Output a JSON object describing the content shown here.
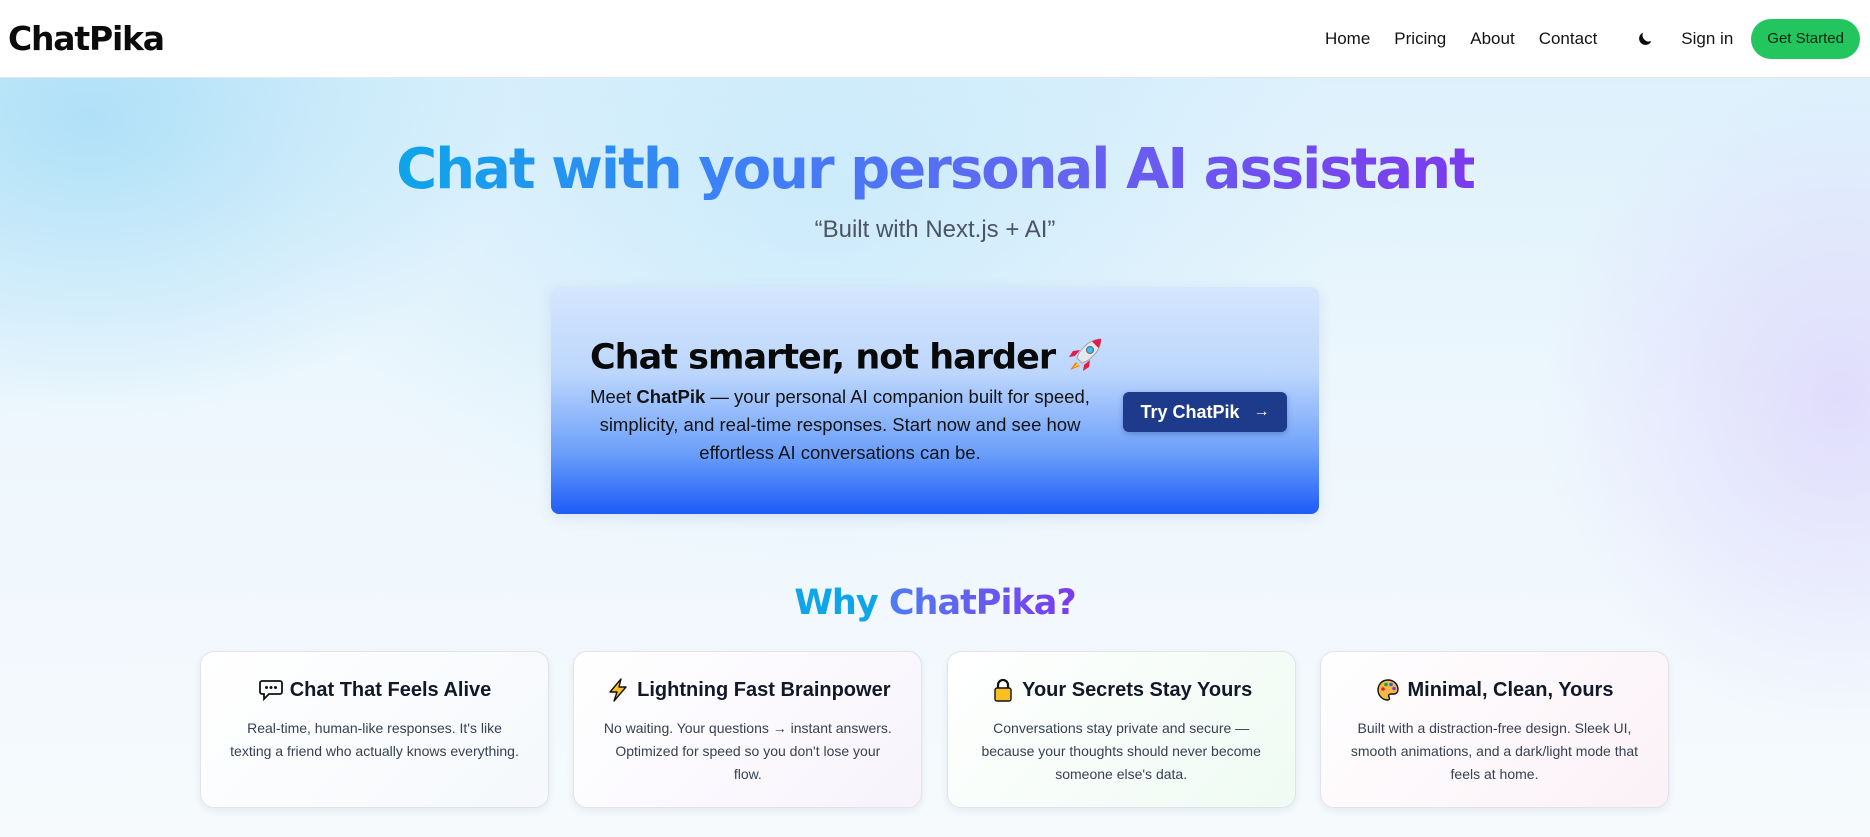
{
  "nav": {
    "brand": "ChatPika",
    "links": [
      "Home",
      "Pricing",
      "About",
      "Contact"
    ],
    "theme_toggle_icon": "moon-icon",
    "signin": "Sign in",
    "cta": "Get Started",
    "cta_color": "#22c55e"
  },
  "hero": {
    "title": "Chat with your personal AI assistant",
    "subtitle": "“Built with Next.js + AI”"
  },
  "cta_card": {
    "title": "Chat smarter, not harder",
    "title_icon": "rocket-icon",
    "text_before": "Meet ",
    "text_bold": "ChatPik",
    "text_after": " — your personal AI companion built for speed, simplicity, and real-time responses. Start now and see how effortless AI conversations can be.",
    "button": "Try ChatPik",
    "button_arrow": "→",
    "button_color": "#1e3a8a"
  },
  "why": {
    "title_part1": "Why ",
    "title_part2": "ChatPika?",
    "features": [
      {
        "icon": "speech-bubble-icon",
        "title": "Chat That Feels Alive",
        "desc": "Real-time, human-like responses. It's like texting a friend who actually knows everything."
      },
      {
        "icon": "lightning-icon",
        "title": "Lightning Fast Brainpower",
        "desc": "No waiting. Your questions → instant answers. Optimized for speed so you don't lose your flow."
      },
      {
        "icon": "lock-icon",
        "title": "Your Secrets Stay Yours",
        "desc": "Conversations stay private and secure — because your thoughts should never become someone else's data."
      },
      {
        "icon": "palette-icon",
        "title": "Minimal, Clean, Yours",
        "desc": "Built with a distraction-free design. Sleek UI, smooth animations, and a dark/light mode that feels at home."
      }
    ]
  }
}
